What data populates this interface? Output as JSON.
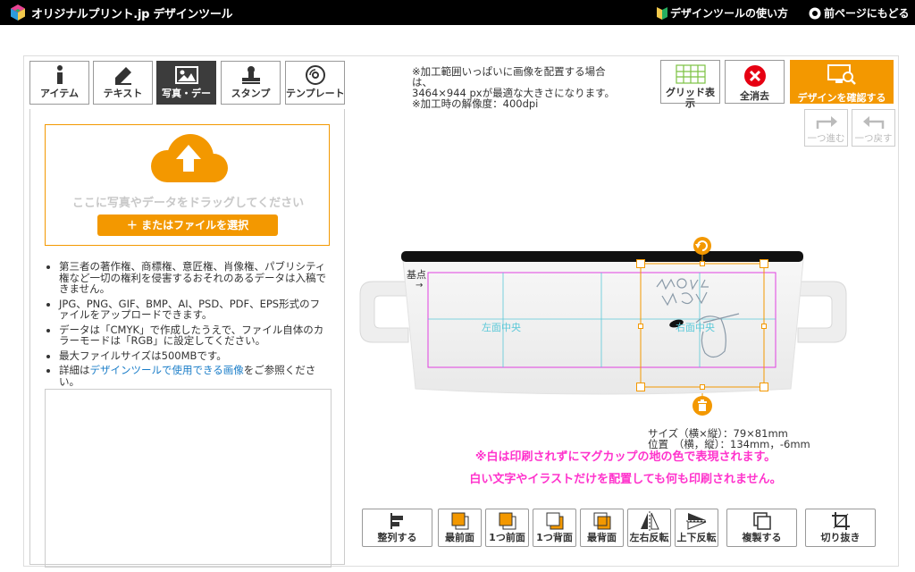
{
  "header": {
    "logo_text": "オリジナルプリント.jp デザインツール",
    "guide_link": "デザインツールの使い方",
    "back_link": "前ページにもどる"
  },
  "tabs": [
    {
      "label": "アイテム"
    },
    {
      "label": "テキスト"
    },
    {
      "label": "写真・デー"
    },
    {
      "label": "スタンプ"
    },
    {
      "label": "テンプレート"
    }
  ],
  "upload": {
    "drop_hint": "ここに写真やデータをドラッグしてください",
    "file_button": "＋ またはファイルを選択"
  },
  "notes": {
    "n1": "第三者の著作権、商標権、意匠権、肖像権、パブリシティ権など一切の権利を侵害するおそれのあるデータは入稿できません。",
    "n2": "JPG、PNG、GIF、BMP、AI、PSD、PDF、EPS形式のファイルをアップロードできます。",
    "n3": "データは「CMYK」で作成したうえで、ファイル自体のカラーモードは「RGB」に設定してください。",
    "n4": "最大ファイルサイズは500MBです。",
    "n5_pre": "詳細は",
    "n5_link": "デザインツールで使用できる画像",
    "n5_post": "をご参照ください。"
  },
  "info": {
    "line1": "※加工範囲いっぱいに画像を配置する場合は、",
    "line2": "3464×944 pxが最適な大きさになります。",
    "line3": "※加工時の解像度：400dpi"
  },
  "top_buttons": {
    "grid": "グリッド表示",
    "clear": "全消去",
    "confirm": "デザインを確認する",
    "redo": "一つ進む",
    "undo": "一つ戻す"
  },
  "canvas": {
    "base_point": "基点",
    "left_center": "左面中央",
    "right_center": "右面中央"
  },
  "size_info": {
    "size": "サイズ（横×縦）：79×81mm",
    "position": "位置　（横，縦）：134mm，-6mm"
  },
  "warning": {
    "line1": "※白は印刷されずにマグカップの地の色で表現されます。",
    "line2": "白い文字やイラストだけを配置しても何も印刷されません。"
  },
  "toolbar": [
    {
      "label": "整列する"
    },
    {
      "label": "最前面"
    },
    {
      "label": "1つ前面"
    },
    {
      "label": "1つ背面"
    },
    {
      "label": "最背面"
    },
    {
      "label": "左右反転"
    },
    {
      "label": "上下反転"
    },
    {
      "label": "複製する"
    },
    {
      "label": "切り抜き"
    }
  ],
  "colors": {
    "accent": "#f39800",
    "guide_magenta": "#e040e0",
    "guide_cyan": "#5bc8d8",
    "warning": "#ff33cc"
  }
}
